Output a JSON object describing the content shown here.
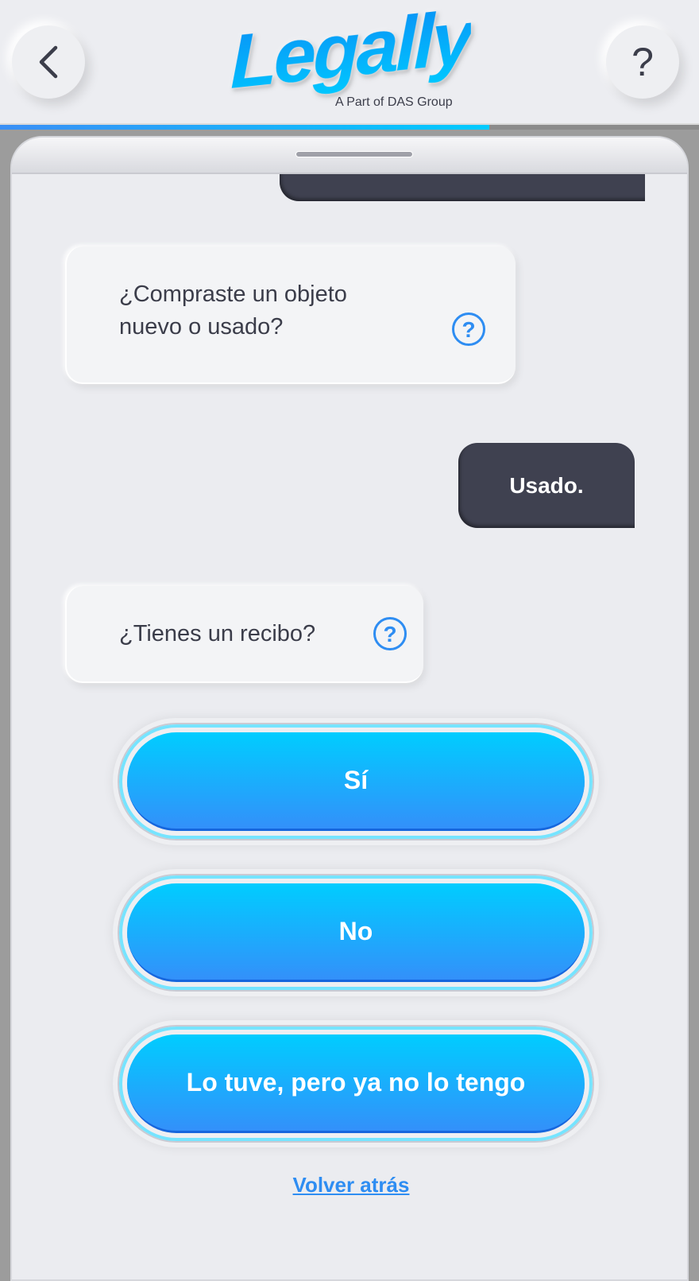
{
  "header": {
    "logo_text": "Legally",
    "logo_subtitle": "A Part of DAS Group",
    "back_icon": "chevron-left-icon",
    "help_label": "?"
  },
  "progress": {
    "percent": 70
  },
  "chat": {
    "messages": [
      {
        "from": "bot",
        "text_lines": [
          "¿Compraste un objeto",
          "nuevo o usado?"
        ],
        "help": "?"
      },
      {
        "from": "user",
        "text": "Usado."
      },
      {
        "from": "bot",
        "text": "¿Tienes un recibo?",
        "help": "?"
      }
    ],
    "options": [
      "Sí",
      "No",
      "Lo tuve, pero ya no lo tengo"
    ],
    "back_link": "Volver atrás"
  },
  "colors": {
    "accent": "#2e8df2",
    "user_bubble": "#3f4150",
    "button_top": "#00cdff",
    "button_bottom": "#3390fa"
  }
}
